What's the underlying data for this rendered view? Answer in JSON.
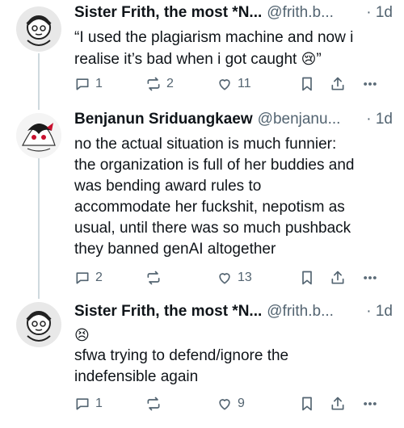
{
  "posts": [
    {
      "name": "Sister Frith, the most *N...",
      "handle": "@frith.b...",
      "time": "1d",
      "text_lines": [
        "“I used the plagiarism machine and now i",
        "realise it’s bad when i got caught"
      ],
      "emoji": "😢",
      "closing_quote": "”",
      "reply_count": "1",
      "repost_count": "2",
      "like_count": "11"
    },
    {
      "name": "Benjanun Sriduangkaew",
      "handle": "@benjanu...",
      "time": "1d",
      "text_lines": [
        "no the actual situation is much funnier:",
        "the organization is full of her buddies and",
        "was bending award rules to",
        "accommodate her fuckshit, nepotism as",
        "usual, until there was so much pushback",
        "they banned genAI altogether"
      ],
      "reply_count": "2",
      "repost_count": "",
      "like_count": "13"
    },
    {
      "name": "Sister Frith, the most *N...",
      "handle": "@frith.b...",
      "time": "1d",
      "emoji": "😣",
      "text_lines": [
        "sfwa trying to defend/ignore the",
        "indefensible again"
      ],
      "reply_count": "1",
      "repost_count": "",
      "like_count": "9"
    }
  ],
  "icons": [
    "reply-icon",
    "repost-icon",
    "like-icon",
    "bookmark-icon",
    "share-icon",
    "more-icon"
  ]
}
